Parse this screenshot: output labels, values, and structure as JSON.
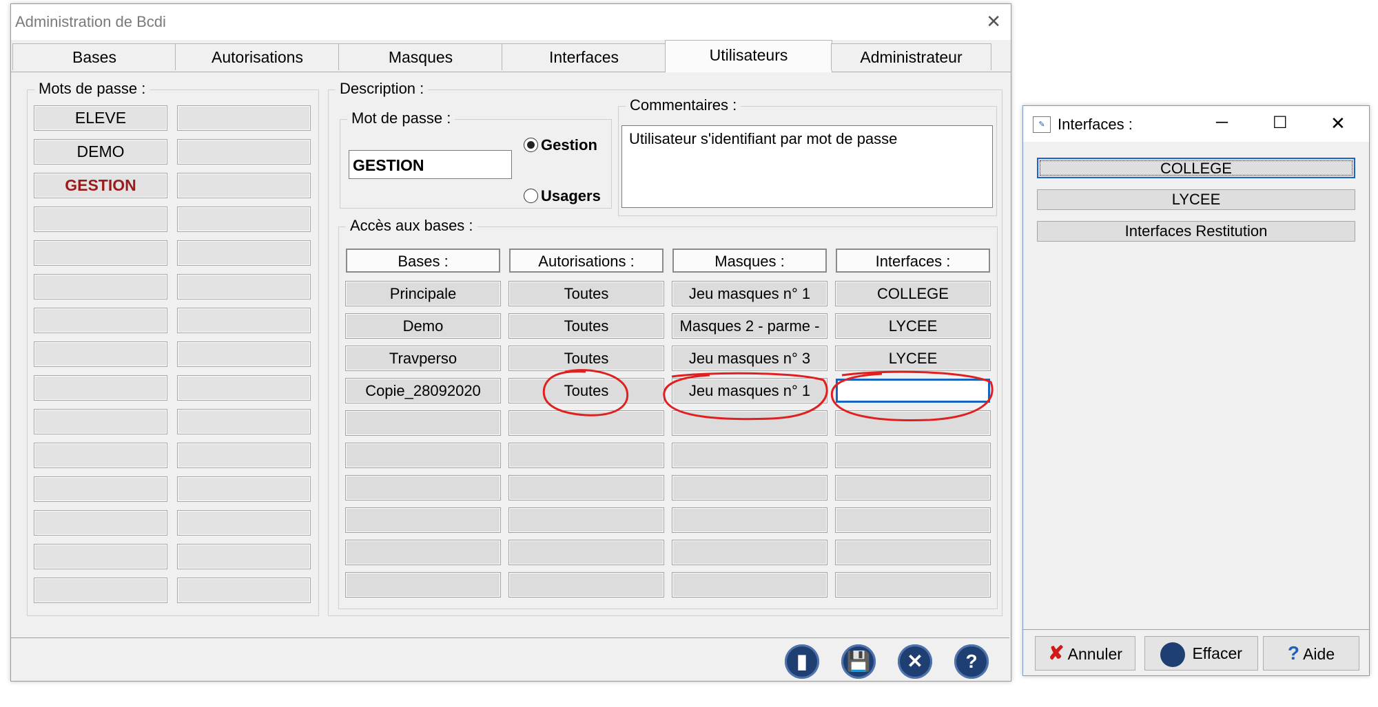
{
  "main_window": {
    "title": "Administration de Bcdi",
    "close_glyph": "✕",
    "tabs": [
      "Bases",
      "Autorisations",
      "Masques",
      "Interfaces",
      "Utilisateurs",
      "Administrateur"
    ],
    "active_tab": "Utilisateurs"
  },
  "passwords": {
    "label": "Mots de passe :",
    "col1": [
      "ELEVE",
      "DEMO",
      "GESTION",
      "",
      "",
      "",
      "",
      "",
      "",
      "",
      "",
      "",
      "",
      "",
      ""
    ],
    "col2": [
      "",
      "",
      "",
      "",
      "",
      "",
      "",
      "",
      "",
      "",
      "",
      "",
      "",
      "",
      ""
    ],
    "highlighted": "GESTION",
    "highlight_color": "#9b1b1b"
  },
  "description": {
    "label": "Description :",
    "password_group_label": "Mot de passe :",
    "password_value": "GESTION",
    "radio_gestion": "Gestion",
    "radio_usagers": "Usagers",
    "selected_radio": "Gestion",
    "comments_label": "Commentaires :",
    "comments_value": "Utilisateur s'identifiant par mot de passe"
  },
  "access": {
    "label": "Accès aux bases :",
    "headers": [
      "Bases :",
      "Autorisations :",
      "Masques :",
      "Interfaces :"
    ],
    "rows": [
      [
        "Principale",
        "Toutes",
        "Jeu masques n° 1",
        "COLLEGE"
      ],
      [
        "Demo",
        "Toutes",
        "Masques 2 - parme -",
        "LYCEE"
      ],
      [
        "Travperso",
        "Toutes",
        "Jeu masques n° 3",
        "LYCEE"
      ],
      [
        "Copie_28092020",
        "Toutes",
        "Jeu masques n° 1",
        ""
      ],
      [
        "",
        "",
        "",
        ""
      ],
      [
        "",
        "",
        "",
        ""
      ],
      [
        "",
        "",
        "",
        ""
      ],
      [
        "",
        "",
        "",
        ""
      ],
      [
        "",
        "",
        "",
        ""
      ],
      [
        "",
        "",
        "",
        ""
      ]
    ]
  },
  "toolbar_icons": [
    "clear-icon",
    "save-icon",
    "cancel-icon",
    "help-icon"
  ],
  "interfaces_window": {
    "title": "Interfaces :",
    "minimize_glyph": "─",
    "maximize_glyph": "☐",
    "close_glyph": "✕",
    "items": [
      "COLLEGE",
      "LYCEE",
      "Interfaces Restitution"
    ],
    "selected_item": "COLLEGE",
    "buttons": {
      "annuler": "Annuler",
      "effacer": "Effacer",
      "aide": "Aide"
    },
    "annuler_icon_color": "#d01919",
    "aide_icon_color": "#1f5fbf"
  },
  "annotation_color": "#e02020"
}
